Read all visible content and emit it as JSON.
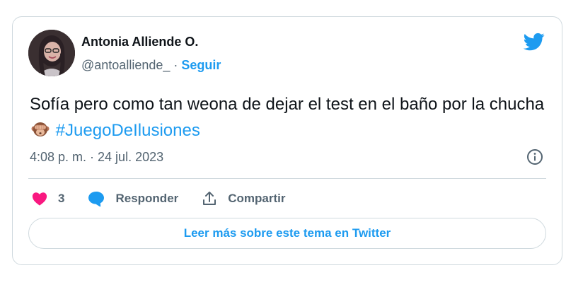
{
  "tweet": {
    "author_name": "Antonia Alliende O.",
    "handle": "@antoalliende_",
    "separator": " · ",
    "follow_label": "Seguir",
    "text_main": "Sofía pero como tan weona de dejar el test en el baño por la chucha",
    "emoji": "see-no-evil-monkey",
    "hashtag": "#JuegoDeIlusiones",
    "timestamp": "4:08 p. m. · 24 jul. 2023"
  },
  "actions": {
    "like_count": "3",
    "reply_label": "Responder",
    "share_label": "Compartir"
  },
  "read_more_label": "Leer más sobre este tema en Twitter",
  "colors": {
    "accent": "#1d9bf0",
    "like": "#f91880",
    "text": "#0f1419",
    "muted": "#536471",
    "border": "#cfd9de"
  }
}
